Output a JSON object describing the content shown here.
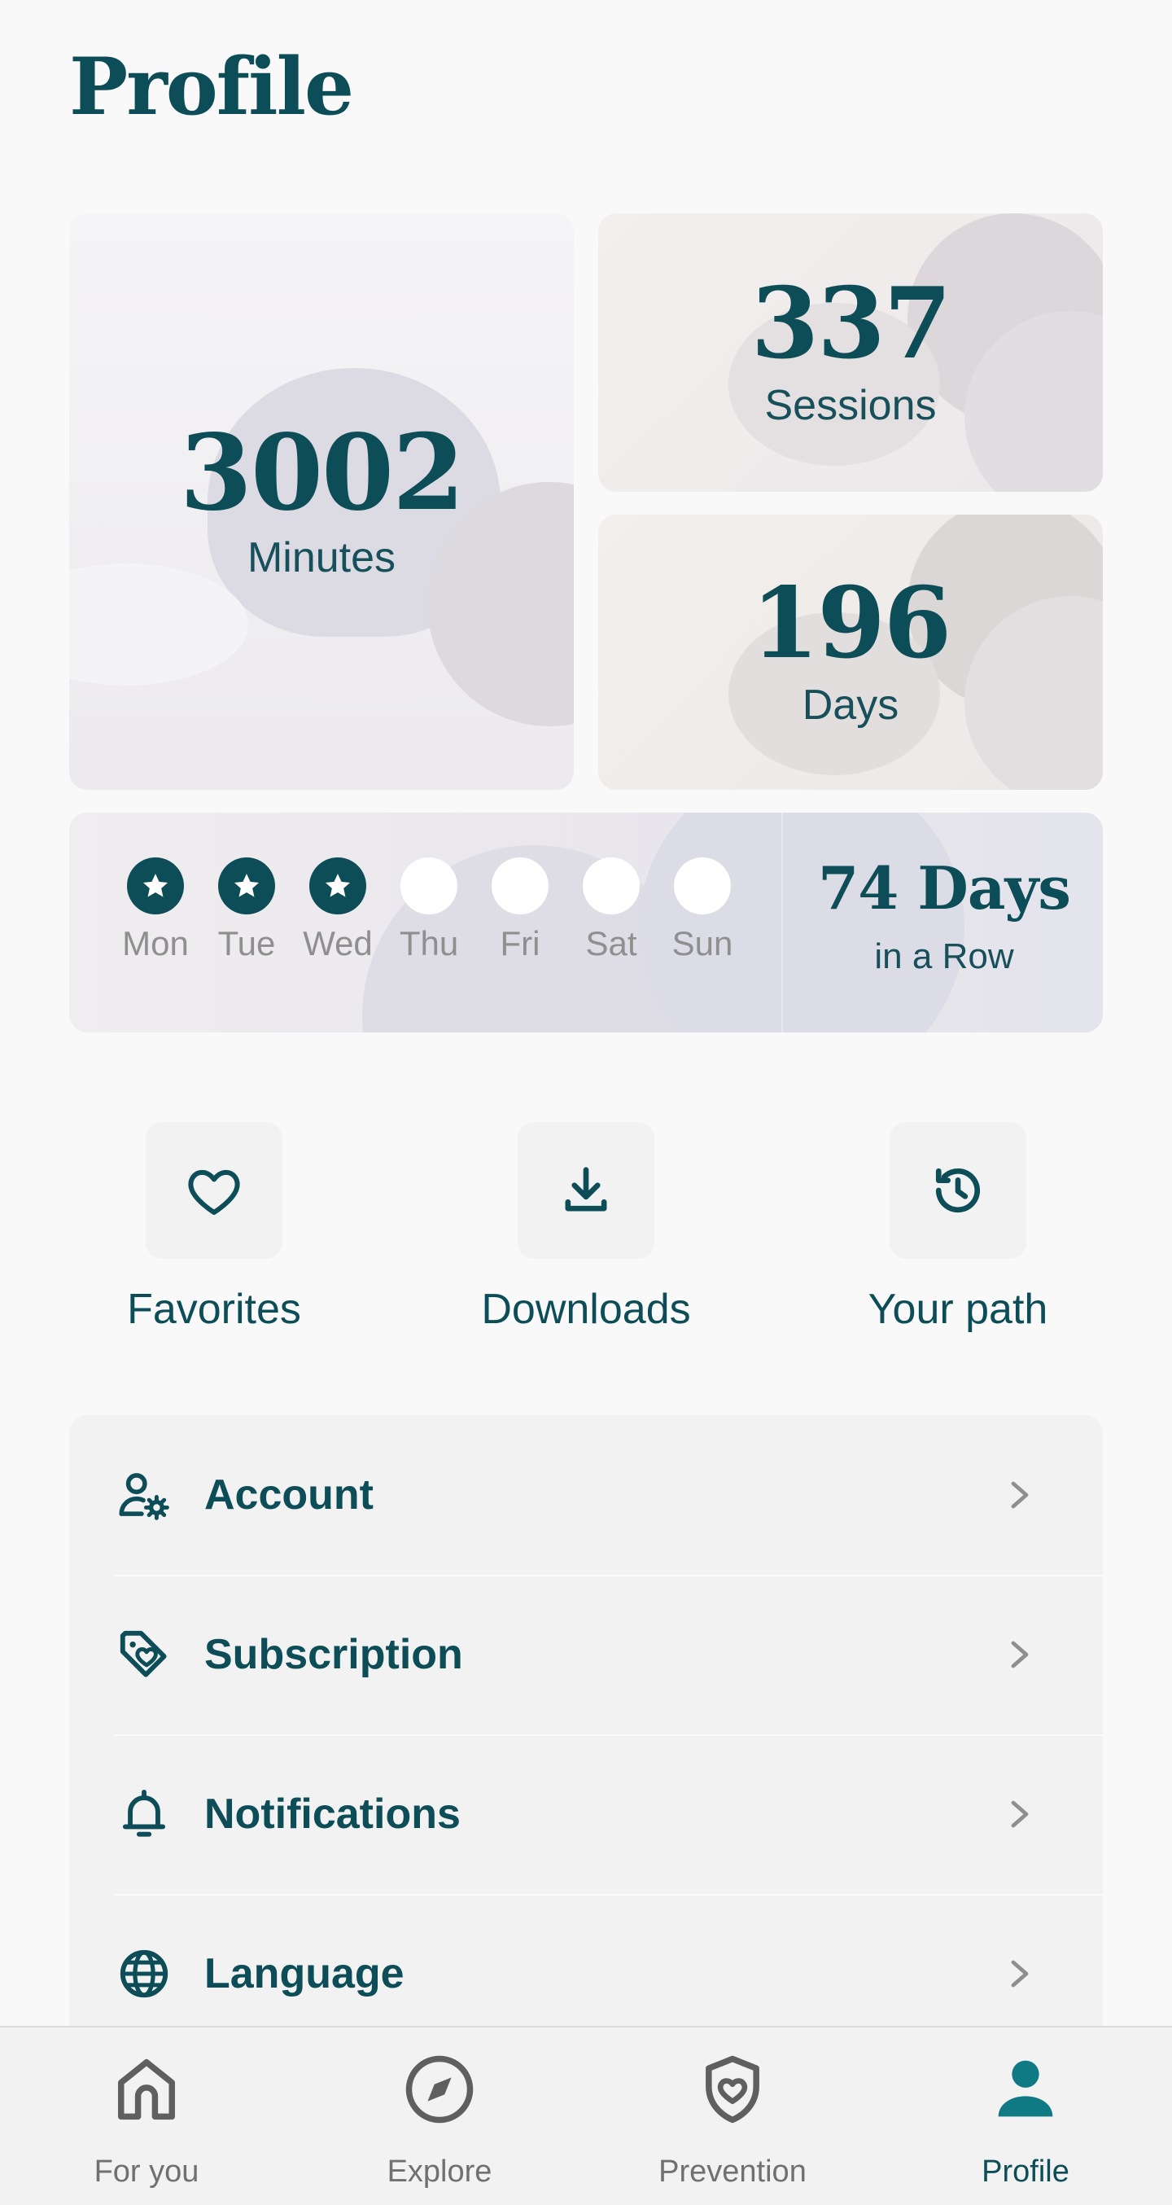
{
  "page": {
    "title": "Profile"
  },
  "stats": {
    "minutes": {
      "value": "3002",
      "label": "Minutes"
    },
    "sessions": {
      "value": "337",
      "label": "Sessions"
    },
    "days": {
      "value": "196",
      "label": "Days"
    }
  },
  "streak": {
    "days": [
      {
        "name": "Mon",
        "done": true
      },
      {
        "name": "Tue",
        "done": true
      },
      {
        "name": "Wed",
        "done": true
      },
      {
        "name": "Thu",
        "done": false
      },
      {
        "name": "Fri",
        "done": false
      },
      {
        "name": "Sat",
        "done": false
      },
      {
        "name": "Sun",
        "done": false
      }
    ],
    "count": "74 Days",
    "subtitle": "in a Row"
  },
  "quick_actions": [
    {
      "label": "Favorites",
      "icon": "heart-icon"
    },
    {
      "label": "Downloads",
      "icon": "download-icon"
    },
    {
      "label": "Your path",
      "icon": "history-icon"
    }
  ],
  "settings": [
    {
      "label": "Account",
      "icon": "user-settings-icon"
    },
    {
      "label": "Subscription",
      "icon": "tag-heart-icon"
    },
    {
      "label": "Notifications",
      "icon": "bell-icon"
    },
    {
      "label": "Language",
      "icon": "globe-icon"
    }
  ],
  "tabs": [
    {
      "label": "For you",
      "icon": "home-icon",
      "active": false
    },
    {
      "label": "Explore",
      "icon": "compass-icon",
      "active": false
    },
    {
      "label": "Prevention",
      "icon": "shield-heart-icon",
      "active": false
    },
    {
      "label": "Profile",
      "icon": "person-icon",
      "active": true
    }
  ],
  "colors": {
    "primary": "#0d4d57",
    "accent": "#0f7a84",
    "muted": "#8f8f8f",
    "background": "#f9f9fa"
  }
}
